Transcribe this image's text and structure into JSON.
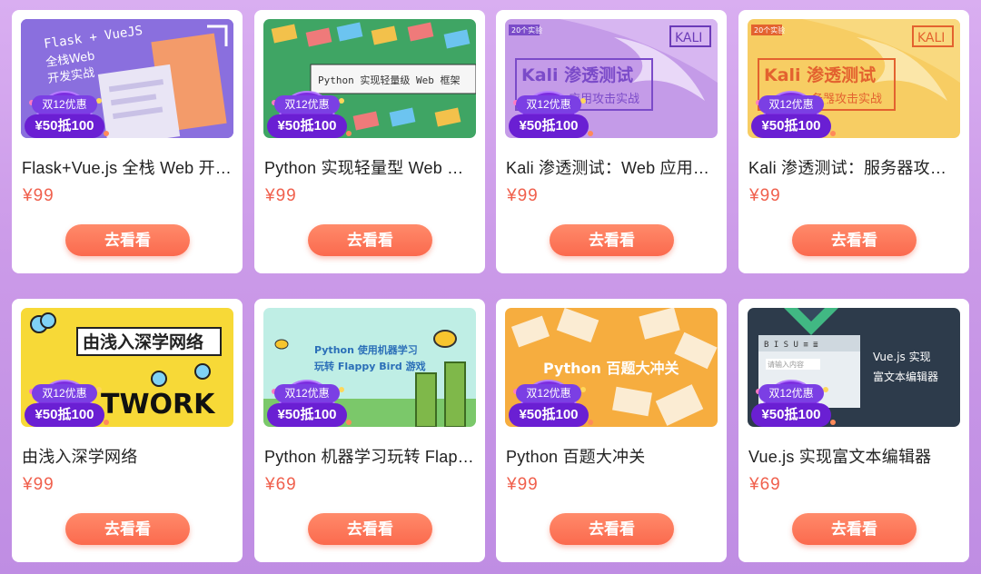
{
  "promo": {
    "badge_top": "双12优惠",
    "badge_main": "¥50抵100"
  },
  "button_label": "去看看",
  "courses": [
    {
      "title": "Flask+Vue.js 全栈 Web 开发实战",
      "price": "¥99",
      "thumb_text": [
        "Flask + VueJS",
        "全栈Web",
        "开发实战"
      ]
    },
    {
      "title": "Python 实现轻量型 Web 框架",
      "price": "¥99",
      "thumb_text": [
        "Python 实现轻量级 Web 框架"
      ]
    },
    {
      "title": "Kali 渗透测试：Web 应用攻击实战",
      "price": "¥99",
      "thumb_text": [
        "20个实验",
        "KALI",
        "Kali 渗透测试",
        "应用攻击实战"
      ]
    },
    {
      "title": "Kali 渗透测试：服务器攻击实战",
      "price": "¥99",
      "thumb_text": [
        "20个实验",
        "KALI",
        "Kali 渗透测试",
        "务器攻击实战"
      ]
    },
    {
      "title": "由浅入深学网络",
      "price": "¥99",
      "thumb_text": [
        "由浅入深学网络",
        "TWORK"
      ]
    },
    {
      "title": "Python 机器学习玩转 Flappy Bird 游戏",
      "price": "¥69",
      "thumb_text": [
        "Python 使用机器学习",
        "玩转 Flappy Bird 游戏"
      ]
    },
    {
      "title": "Python 百题大冲关",
      "price": "¥99",
      "thumb_text": [
        "Python 百题大冲关"
      ]
    },
    {
      "title": "Vue.js 实现富文本编辑器",
      "price": "¥69",
      "thumb_text": [
        "Vue.js 实现",
        "富文本编辑器",
        "请输入内容"
      ]
    }
  ],
  "colors": {
    "price": "#f0604d",
    "button": "#fb6a4e",
    "badge": "#6a1fd3"
  }
}
